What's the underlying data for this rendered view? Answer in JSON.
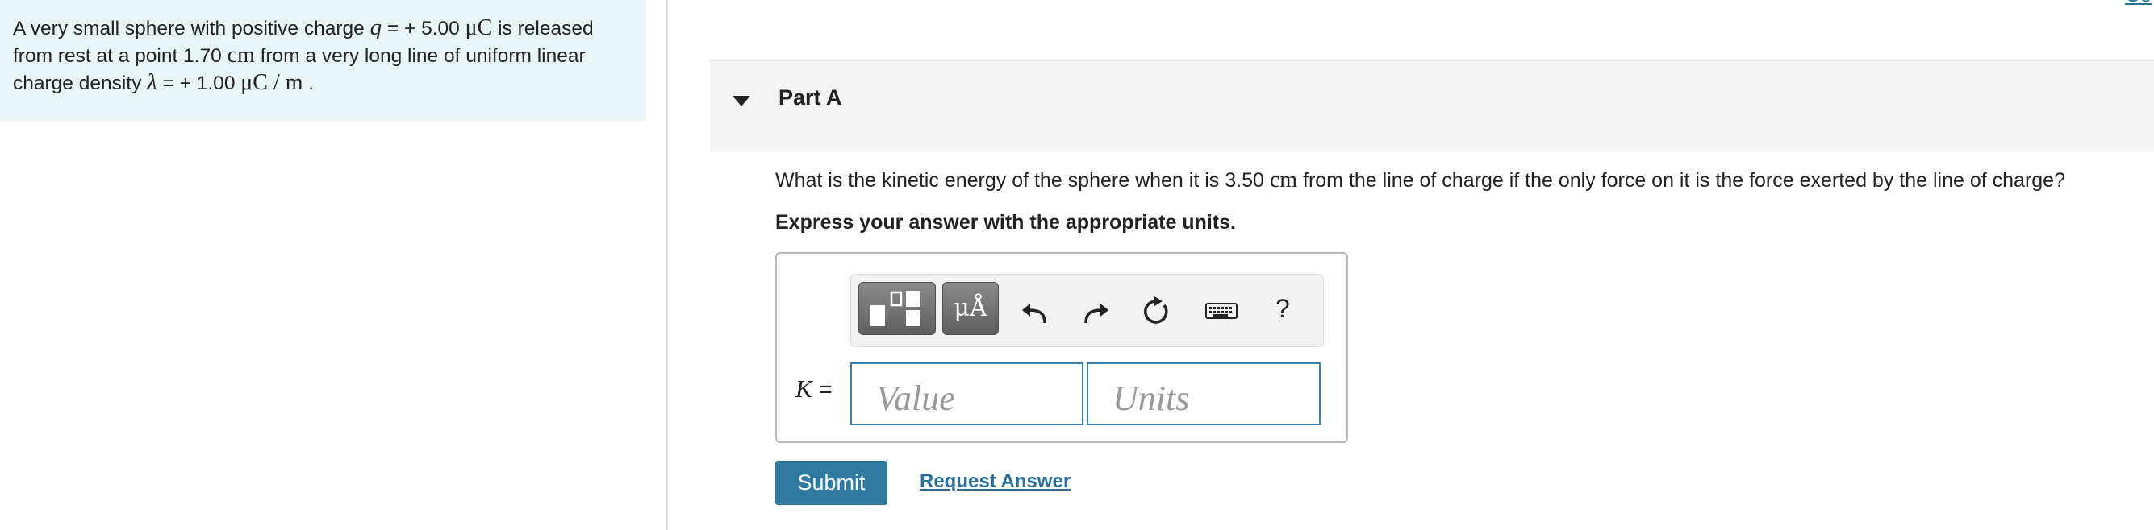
{
  "problem": {
    "seg1": "A very small sphere with positive charge ",
    "q_symbol": "q",
    "seg2": " = + 5.00 ",
    "charge_unit": "μC",
    "seg3": " is released from rest at a point 1.70 ",
    "dist_unit": "cm",
    "seg4": " from a very long line of uniform linear charge density ",
    "lambda_symbol": "λ",
    "seg5": " = + 1.00 ",
    "density_unit": "μC / m",
    "seg6": " ."
  },
  "corner_link": "Co",
  "part": {
    "title": "Part A"
  },
  "question": {
    "seg1": "What is the kinetic energy of the sphere when it is 3.50 ",
    "unit": "cm",
    "seg2": " from the line of charge if the only force on it is the force exerted by the line of charge?"
  },
  "instruction": "Express your answer with the appropriate units.",
  "toolbar": {
    "units_label": "μÅ",
    "help_label": "?",
    "icons": [
      "templates-icon",
      "units-icon",
      "undo-icon",
      "redo-icon",
      "reset-icon",
      "keyboard-icon",
      "help-icon"
    ]
  },
  "answer": {
    "variable": "K",
    "equals": " =",
    "value_placeholder": "Value",
    "units_placeholder": "Units"
  },
  "buttons": {
    "submit": "Submit",
    "request_answer": "Request Answer"
  },
  "colors": {
    "accent": "#2f7aa1",
    "problem_bg": "#e8f4f6",
    "field_border": "#3e7fa8"
  }
}
